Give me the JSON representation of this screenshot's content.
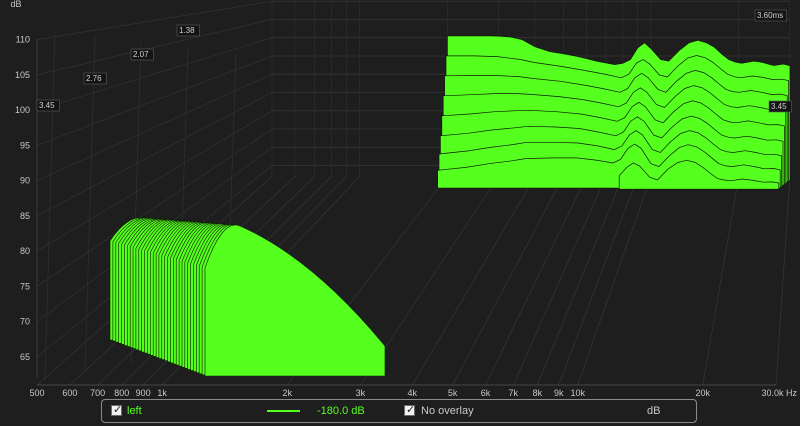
{
  "chart_data": {
    "type": "area",
    "subtype": "waterfall",
    "y_unit": "dB",
    "ylim": [
      62,
      110
    ],
    "y_ticks": [
      "65",
      "70",
      "75",
      "80",
      "85",
      "90",
      "95",
      "100",
      "105",
      "110"
    ],
    "x_unit": "Hz",
    "x_scale": "log",
    "xlim": [
      500,
      30000
    ],
    "x_ticks": [
      {
        "v": 500,
        "label": "500"
      },
      {
        "v": 600,
        "label": "600"
      },
      {
        "v": 700,
        "label": "700"
      },
      {
        "v": 800,
        "label": "800"
      },
      {
        "v": 900,
        "label": "900"
      },
      {
        "v": 1000,
        "label": "1k"
      },
      {
        "v": 2000,
        "label": "2k"
      },
      {
        "v": 3000,
        "label": "3k"
      },
      {
        "v": 4000,
        "label": "4k"
      },
      {
        "v": 5000,
        "label": "5k"
      },
      {
        "v": 6000,
        "label": "6k"
      },
      {
        "v": 7000,
        "label": "7k"
      },
      {
        "v": 8000,
        "label": "8k"
      },
      {
        "v": 9000,
        "label": "9k"
      },
      {
        "v": 10000,
        "label": "10k"
      },
      {
        "v": 20000,
        "label": "20k"
      },
      {
        "v": 30000,
        "label": "30.0k Hz"
      }
    ],
    "time_labels": [
      "3.45",
      "2.76",
      "2.07",
      "1.38",
      "3.60ms",
      "3.45"
    ],
    "fill_color": "#55ff1e",
    "line_color": "#0d1a05",
    "grid": true,
    "series": [
      {
        "x": [
          2000,
          2200,
          2500,
          2800,
          3000,
          3300,
          3600,
          4000,
          4500,
          5000,
          5500,
          6000,
          6500,
          7000,
          7500,
          8000,
          8500,
          9000,
          9500,
          10000,
          10800,
          11500,
          12500,
          13500,
          14500,
          15500,
          16500,
          17500,
          18500,
          19500,
          20500,
          21500,
          22500,
          23500,
          24500,
          25500,
          26500,
          27500,
          28500,
          30000
        ],
        "y": [
          100.5,
          100.5,
          100.5,
          100.5,
          100.4,
          100.2,
          99.5,
          97.5,
          96.2,
          95.6,
          95.0,
          94.3,
          93.6,
          93.1,
          92.6,
          93.0,
          94.0,
          97.2,
          98.6,
          97.0,
          94.0,
          93.6,
          96.5,
          98.6,
          99.3,
          98.6,
          97.4,
          95.5,
          94.0,
          93.3,
          93.0,
          93.3,
          93.6,
          93.4,
          93.1,
          92.7,
          92.4,
          92.6,
          92.8,
          92.3
        ]
      },
      {
        "x": [
          2000,
          2500,
          3000,
          3600,
          4000,
          5000,
          6000,
          7000,
          8000,
          8500,
          9000,
          9500,
          10000,
          10800,
          11500,
          12500,
          13500,
          14500,
          15500,
          16500,
          17500,
          18500,
          19500,
          20500,
          22500,
          24500,
          26500,
          28500,
          30000
        ],
        "y": [
          97.0,
          97.0,
          96.8,
          96.0,
          95.2,
          94.1,
          93.0,
          92.0,
          91.0,
          92.0,
          95.0,
          96.0,
          94.8,
          91.8,
          91.2,
          94.2,
          96.4,
          97.1,
          96.5,
          95.2,
          93.5,
          92.0,
          91.3,
          91.0,
          91.5,
          91.1,
          90.5,
          90.6,
          90.2
        ]
      },
      {
        "x": [
          2000,
          2500,
          3000,
          3600,
          4000,
          5000,
          6000,
          7000,
          8000,
          8500,
          9000,
          9500,
          10000,
          10800,
          11500,
          12500,
          13500,
          14500,
          15500,
          16500,
          17500,
          18500,
          19500,
          20500,
          22500,
          24500,
          26500,
          28500,
          30000
        ],
        "y": [
          93.5,
          93.6,
          93.6,
          93.3,
          92.8,
          92.0,
          91.0,
          90.0,
          89.0,
          90.0,
          93.0,
          94.2,
          93.0,
          89.8,
          89.0,
          92.0,
          94.2,
          95.0,
          94.4,
          93.0,
          91.3,
          89.8,
          89.2,
          89.0,
          89.5,
          89.0,
          88.4,
          88.5,
          88.1
        ]
      },
      {
        "x": [
          2000,
          2500,
          3000,
          3600,
          4000,
          5000,
          6000,
          7000,
          8000,
          8500,
          9000,
          9500,
          10000,
          10800,
          11500,
          12500,
          13500,
          14500,
          15500,
          16500,
          17500,
          18500,
          19500,
          20500,
          22500,
          24500,
          26500,
          28500,
          30000
        ],
        "y": [
          90.0,
          90.3,
          90.6,
          90.6,
          90.4,
          89.8,
          89.0,
          88.0,
          87.0,
          88.0,
          91.0,
          92.2,
          91.0,
          87.6,
          86.8,
          89.8,
          92.0,
          92.8,
          92.2,
          90.8,
          89.1,
          87.6,
          87.0,
          86.8,
          87.3,
          86.8,
          86.2,
          86.3,
          85.9
        ]
      },
      {
        "x": [
          2000,
          2500,
          3000,
          3600,
          4000,
          5000,
          6000,
          7000,
          8000,
          8500,
          9000,
          9500,
          10000,
          10800,
          11500,
          12500,
          13500,
          14500,
          15500,
          16500,
          17500,
          18500,
          19500,
          20500,
          22500,
          24500,
          26500,
          28500,
          30000
        ],
        "y": [
          86.5,
          87.0,
          87.6,
          87.9,
          88.0,
          87.6,
          87.0,
          86.0,
          85.0,
          86.0,
          89.0,
          90.2,
          89.0,
          85.4,
          84.6,
          87.6,
          89.8,
          90.6,
          90.0,
          88.6,
          86.9,
          85.4,
          84.8,
          84.6,
          85.1,
          84.6,
          84.0,
          84.1,
          83.7
        ]
      },
      {
        "x": [
          2000,
          2500,
          3000,
          3600,
          4000,
          5000,
          6000,
          7000,
          8000,
          8500,
          9000,
          9500,
          10000,
          10800,
          11500,
          12500,
          13500,
          14500,
          15500,
          16500,
          17500,
          18500,
          19500,
          20500,
          22500,
          24500,
          26500,
          28500,
          30000
        ],
        "y": [
          83.0,
          83.7,
          84.6,
          85.2,
          85.6,
          85.4,
          85.0,
          84.0,
          83.0,
          84.0,
          87.0,
          88.2,
          87.0,
          83.2,
          82.4,
          85.4,
          87.6,
          88.4,
          87.8,
          86.4,
          84.7,
          83.2,
          82.6,
          82.4,
          82.9,
          82.4,
          81.8,
          81.9,
          81.5
        ]
      },
      {
        "x": [
          2000,
          2500,
          3000,
          3600,
          4000,
          5000,
          6000,
          7000,
          8000,
          8500,
          9000,
          9500,
          10000,
          10800,
          11500,
          12500,
          13500,
          14500,
          15500,
          16500,
          17500,
          18500,
          19500,
          20500,
          22500,
          24500,
          26500,
          28500,
          30000
        ],
        "y": [
          80.0,
          80.8,
          81.8,
          82.6,
          83.2,
          83.2,
          83.0,
          82.2,
          81.2,
          82.2,
          85.2,
          86.4,
          85.2,
          81.2,
          80.4,
          83.4,
          85.6,
          86.4,
          85.8,
          84.4,
          82.7,
          81.2,
          80.6,
          80.4,
          80.9,
          80.4,
          79.8,
          79.9,
          79.5
        ]
      },
      {
        "x": [
          2000,
          2500,
          3000,
          3600,
          4000,
          5000,
          6000,
          7000,
          8000,
          8500,
          9000,
          9500,
          10000,
          10800,
          11500,
          12500,
          13500,
          14500,
          15500,
          16500,
          17500,
          18500,
          19500,
          20500,
          22500,
          24500,
          26500,
          28500,
          30000
        ],
        "y": [
          77.5,
          78.3,
          79.3,
          80.1,
          80.7,
          80.9,
          80.9,
          80.3,
          79.5,
          80.5,
          83.5,
          84.7,
          83.5,
          79.3,
          78.5,
          81.5,
          83.7,
          84.5,
          83.9,
          82.5,
          80.8,
          79.3,
          78.7,
          78.5,
          79.0,
          78.5,
          77.9,
          78.0,
          77.6
        ]
      },
      {
        "x": [
          8500,
          9000,
          9500,
          10000,
          10800,
          11500,
          12500,
          13500,
          14500,
          15500,
          16500,
          17500,
          18500,
          19500,
          20500,
          22500,
          24500,
          26500,
          28500,
          30000
        ],
        "y": [
          78.0,
          80.2,
          81.5,
          80.6,
          77.6,
          76.8,
          79.8,
          81.6,
          82.2,
          81.6,
          80.2,
          78.6,
          77.2,
          76.8,
          76.6,
          77.1,
          76.7,
          76.2,
          76.3,
          76.0
        ]
      }
    ]
  },
  "legend": {
    "left_label": "left",
    "value": "-180.0 dB",
    "overlay_label": "No overlay",
    "unit": "dB"
  }
}
